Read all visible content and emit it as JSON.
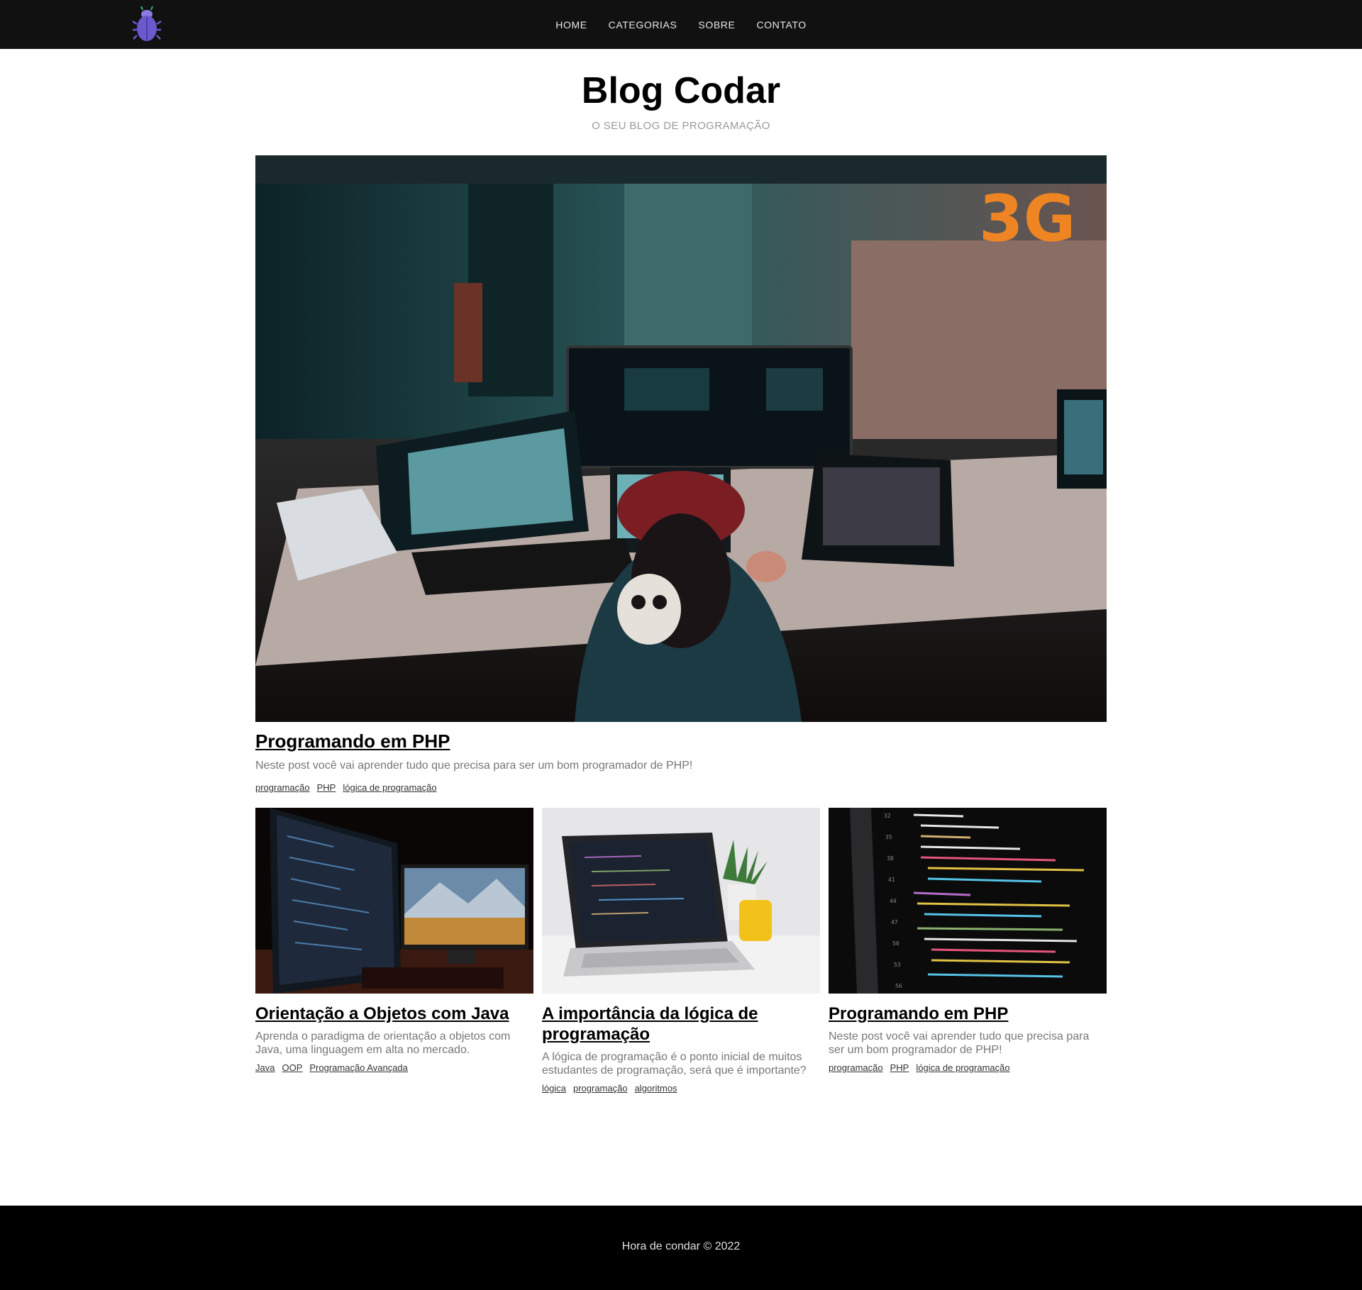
{
  "nav": {
    "logo": "bug-logo",
    "items": [
      {
        "label": "HOME"
      },
      {
        "label": "CATEGORIAS"
      },
      {
        "label": "SOBRE"
      },
      {
        "label": "CONTATO"
      }
    ]
  },
  "header": {
    "title": "Blog Codar",
    "subtitle": "O SEU BLOG DE PROGRAMAÇÃO"
  },
  "featured": {
    "image": "office-workstation-photo",
    "title": "Programando em PHP",
    "description": "Neste post você vai aprender tudo que precisa para ser um bom programador de PHP!",
    "tags": [
      "programação",
      "PHP",
      "lógica de programação"
    ]
  },
  "posts": [
    {
      "image": "dual-monitor-desk-photo",
      "title": "Orientação a Objetos com Java",
      "description": "Aprenda o paradigma de orientação a objetos com Java, uma linguagem em alta no mercado.",
      "tags": [
        "Java",
        "OOP",
        "Programação Avançada"
      ]
    },
    {
      "image": "laptop-code-photo",
      "title": "A importância da lógica de programação",
      "description": "A lógica de programação é o ponto inicial de muitos estudantes de programação, será que é importante?",
      "tags": [
        "lógica",
        "programação",
        "algoritmos"
      ]
    },
    {
      "image": "python-code-screen-photo",
      "title": "Programando em PHP",
      "description": "Neste post você vai aprender tudo que precisa para ser um bom programador de PHP!",
      "tags": [
        "programação",
        "PHP",
        "lógica de programação"
      ]
    }
  ],
  "footer": {
    "text": "Hora de condar © 2022"
  },
  "colors": {
    "navbar": "#111111",
    "footer": "#000000",
    "logo_bug": "#6a5acd",
    "subtitle": "#9a9a9a",
    "description": "#777777"
  }
}
